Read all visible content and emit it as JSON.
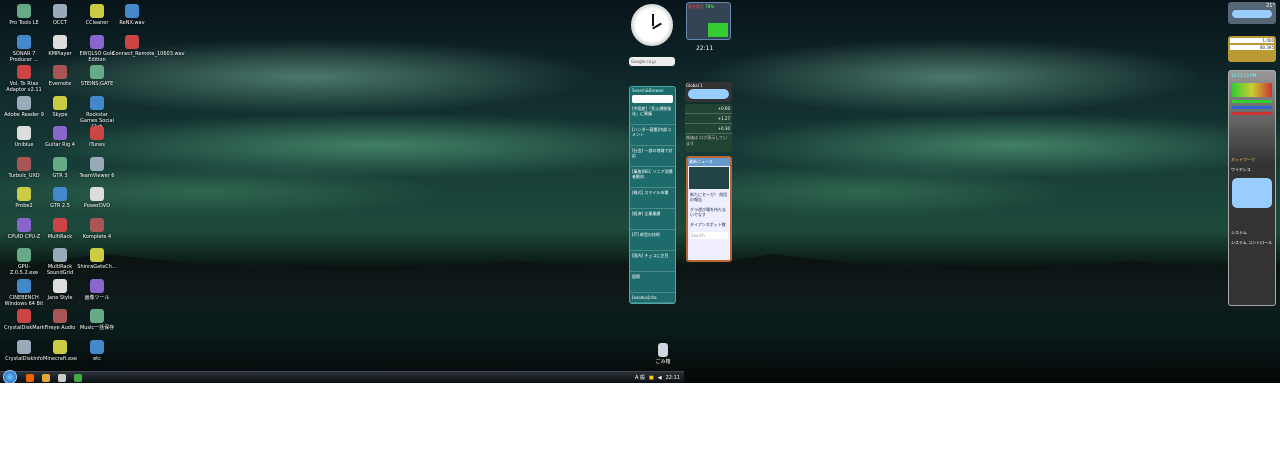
{
  "desktop_left": {
    "columns": [
      [
        "Pro Tools LE",
        "SONAR 7 Producer ...",
        "Vol. To Rtas Adaptor v2.11",
        "Adobe Reader 9",
        "Uniblue",
        "Turbolc_UXO",
        "Probe2",
        "CPUID CPU-Z",
        "GPU-Z.0.5.2.exe",
        "CINEBENCH Windows 64 Bit",
        "CrystalDiskMark",
        "CrystalDiskInfo"
      ],
      [
        "OCCT",
        "KMPlayer",
        "Evernote",
        "Skype",
        "Guitar Rig 4",
        "GTR 3",
        "GTR 2.5",
        "MultiRack",
        "MultiRack SoundGrid",
        "Jane Style",
        "Fireye Audio",
        "Minecraft.exe"
      ],
      [
        "CCleaner",
        "EWQLSO Gold Edition",
        "STEINS;GATE",
        "Rockstar Games Social Club",
        "iTunes",
        "TeamViewer 6",
        "PowerDVD",
        "Komplete 4",
        "ShinraGateCh...",
        "画像ツール",
        "Music一括保存",
        "etc"
      ],
      [
        "ReNX.wav",
        "Connect_Remote_10603.wav"
      ]
    ],
    "recycle_bin": "ごみ箱"
  },
  "taskbar": {
    "clock": "22:11",
    "ime": "A 般"
  },
  "gadgets": {
    "google_search": "Google.co.jp",
    "news": {
      "title": "Search&Browse",
      "items": [
        "[中国産]「死止規制強化」に異議",
        "[ハンダー基盤]内部コメント",
        "[社会] 一部の地域で対応",
        "[事故]NEC ソニア消費者動向",
        "[株式] スマイル市場",
        "[経済] 企業業績",
        "[IT] 新型の技術",
        "[国内] チェコに注目",
        "国際"
      ],
      "footer": "[exodus]cha"
    },
    "power": {
      "title": "東京電力",
      "percent": "78%"
    },
    "time": "22:11",
    "weather_left": "Global 1",
    "stocks": [
      {
        "change": "+0.60"
      },
      {
        "change": "+1.27"
      },
      {
        "change": "+0.30"
      }
    ],
    "stocks_footer": "株価は ログ表示しています",
    "rss": {
      "title": "最新ニュース",
      "search": "Search",
      "items": [
        "新たにセーガ！ 前回の報告",
        "グラ遊び場を持たないでなす",
        "タイアンスポット数"
      ]
    },
    "currency": {
      "usd": "1.000",
      "jpy": "80.395"
    },
    "weather_right": "21°",
    "sysmon": {
      "time": "10:11:13 PM",
      "network": "ネットワーク",
      "wireless": "ワイヤレス",
      "system": "システム",
      "control": "システム コントロール"
    }
  },
  "colors": {
    "gadget_teal": "#1d6b6b",
    "taskbar": "#0c1014"
  }
}
